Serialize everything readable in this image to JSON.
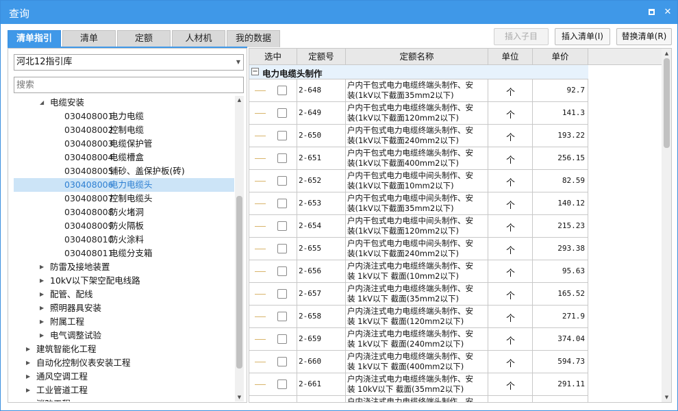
{
  "window": {
    "title": "查询",
    "maximize_icon": "maximize-icon",
    "close_icon": "close-icon",
    "close_glyph": "✕"
  },
  "tabs": [
    {
      "label": "清单指引",
      "active": true
    },
    {
      "label": "清单",
      "active": false
    },
    {
      "label": "定额",
      "active": false
    },
    {
      "label": "人材机",
      "active": false
    },
    {
      "label": "我的数据",
      "active": false
    }
  ],
  "toolbar": {
    "insert_child_label": "插入子目",
    "insert_list_label": "插入清单(I)",
    "replace_list_label": "替换清单(R)"
  },
  "left": {
    "library_selected": "河北12指引库",
    "search_placeholder": "搜索",
    "tree": [
      {
        "indent": 2,
        "expanded": true,
        "code": "",
        "label": "电缆安装"
      },
      {
        "indent": 3,
        "code": "030408001",
        "label": "电力电缆"
      },
      {
        "indent": 3,
        "code": "030408002",
        "label": "控制电缆"
      },
      {
        "indent": 3,
        "code": "030408003",
        "label": "电缆保护管"
      },
      {
        "indent": 3,
        "code": "030408004",
        "label": "电缆槽盒"
      },
      {
        "indent": 3,
        "code": "030408005",
        "label": "铺砂、盖保护板(砖)"
      },
      {
        "indent": 3,
        "code": "030408006",
        "label": "电力电缆头",
        "selected": true
      },
      {
        "indent": 3,
        "code": "030408007",
        "label": "控制电缆头"
      },
      {
        "indent": 3,
        "code": "030408008",
        "label": "防火堵洞"
      },
      {
        "indent": 3,
        "code": "030408009",
        "label": "防火隔板"
      },
      {
        "indent": 3,
        "code": "030408010",
        "label": "防火涂料"
      },
      {
        "indent": 3,
        "code": "030408011",
        "label": "电缆分支箱"
      },
      {
        "indent": 2,
        "expanded": false,
        "code": "",
        "label": "防雷及接地装置"
      },
      {
        "indent": 2,
        "expanded": false,
        "code": "",
        "label": "10kV以下架空配电线路"
      },
      {
        "indent": 2,
        "expanded": false,
        "code": "",
        "label": "配管、配线"
      },
      {
        "indent": 2,
        "expanded": false,
        "code": "",
        "label": "照明器具安装"
      },
      {
        "indent": 2,
        "expanded": false,
        "code": "",
        "label": "附属工程"
      },
      {
        "indent": 2,
        "expanded": false,
        "code": "",
        "label": "电气调整试验"
      },
      {
        "indent": 1,
        "expanded": false,
        "code": "",
        "label": "建筑智能化工程"
      },
      {
        "indent": 1,
        "expanded": false,
        "code": "",
        "label": "自动化控制仪表安装工程"
      },
      {
        "indent": 1,
        "expanded": false,
        "code": "",
        "label": "通风空调工程"
      },
      {
        "indent": 1,
        "expanded": false,
        "code": "",
        "label": "工业管道工程"
      },
      {
        "indent": 1,
        "expanded": false,
        "code": "",
        "label": "消防工程"
      }
    ]
  },
  "grid": {
    "headers": [
      "选中",
      "定额号",
      "定额名称",
      "单位",
      "单价"
    ],
    "group_label": "电力电缆头制作",
    "rows": [
      {
        "code": "2-648",
        "name1": "户内干包式电力电缆终端头制作、安",
        "name2": "装(1kV以下截面35mm2以下)",
        "unit": "个",
        "price": "92.7"
      },
      {
        "code": "2-649",
        "name1": "户内干包式电力电缆终端头制作、安",
        "name2": "装(1kV以下截面120mm2以下)",
        "unit": "个",
        "price": "141.3"
      },
      {
        "code": "2-650",
        "name1": "户内干包式电力电缆终端头制作、安",
        "name2": "装(1kV以下截面240mm2以下)",
        "unit": "个",
        "price": "193.22"
      },
      {
        "code": "2-651",
        "name1": "户内干包式电力电缆终端头制作、安",
        "name2": "装(1kV以下截面400mm2以下)",
        "unit": "个",
        "price": "256.15"
      },
      {
        "code": "2-652",
        "name1": "户内干包式电力电缆中间头制作、安",
        "name2": "装(1kV以下截面10mm2以下)",
        "unit": "个",
        "price": "82.59"
      },
      {
        "code": "2-653",
        "name1": "户内干包式电力电缆中间头制作、安",
        "name2": "装(1kV以下截面35mm2以下)",
        "unit": "个",
        "price": "140.12"
      },
      {
        "code": "2-654",
        "name1": "户内干包式电力电缆中间头制作、安",
        "name2": "装(1kV以下截面120mm2以下)",
        "unit": "个",
        "price": "215.23"
      },
      {
        "code": "2-655",
        "name1": "户内干包式电力电缆中间头制作、安",
        "name2": "装(1kV以下截面240mm2以下)",
        "unit": "个",
        "price": "293.38"
      },
      {
        "code": "2-656",
        "name1": "户内浇注式电力电缆终端头制作、安",
        "name2": "装 1kV以下 截面(10mm2以下)",
        "unit": "个",
        "price": "95.63"
      },
      {
        "code": "2-657",
        "name1": "户内浇注式电力电缆终端头制作、安",
        "name2": "装 1kV以下 截面(35mm2以下)",
        "unit": "个",
        "price": "165.52"
      },
      {
        "code": "2-658",
        "name1": "户内浇注式电力电缆终端头制作、安",
        "name2": "装 1kV以下 截面(120mm2以下)",
        "unit": "个",
        "price": "271.9"
      },
      {
        "code": "2-659",
        "name1": "户内浇注式电力电缆终端头制作、安",
        "name2": "装 1kV以下 截面(240mm2以下)",
        "unit": "个",
        "price": "374.04"
      },
      {
        "code": "2-660",
        "name1": "户内浇注式电力电缆终端头制作、安",
        "name2": "装 1kV以下 截面(400mm2以下)",
        "unit": "个",
        "price": "594.73"
      },
      {
        "code": "2-661",
        "name1": "户内浇注式电力电缆终端头制作、安",
        "name2": "装 10kV以下 截面(35mm2以下)",
        "unit": "个",
        "price": "291.11"
      },
      {
        "code": "",
        "name1": "户内浇注式电力电缆终端头制作、安",
        "name2": "",
        "unit": "",
        "price": ""
      }
    ]
  }
}
